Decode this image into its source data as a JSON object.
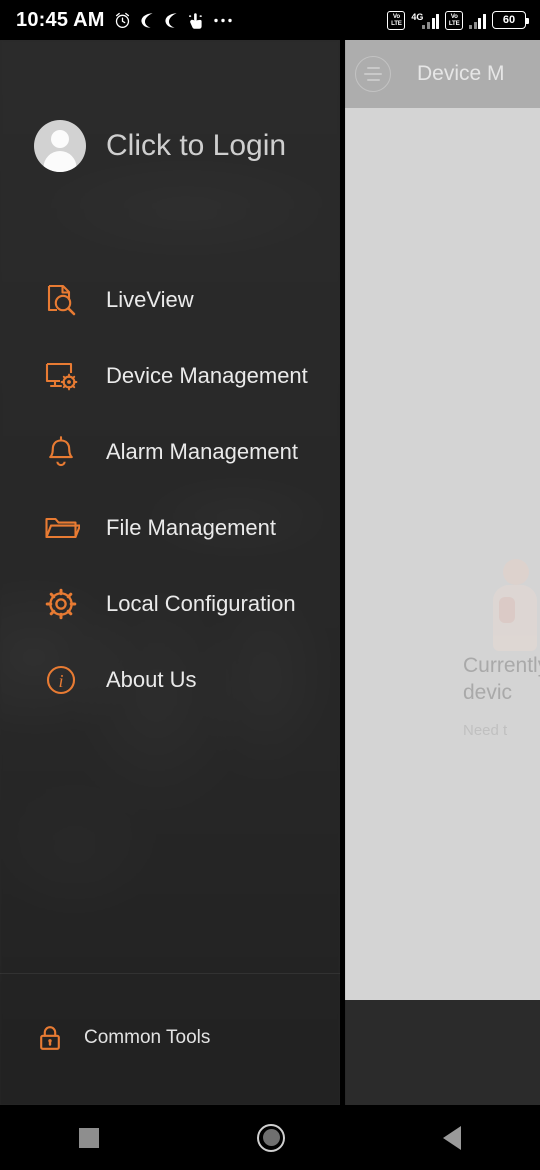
{
  "status_bar": {
    "time": "10:45 AM",
    "left_icons": [
      "alarm-clock-icon",
      "crescent-moon-icon",
      "crescent-moon-icon",
      "touch-assist-icon",
      "more-icon"
    ],
    "network_label_1": "Vo\nLTE",
    "network_top": "Vo",
    "network_bottom": "LTE",
    "data_type": "4G",
    "battery_percent": "60"
  },
  "drawer": {
    "login": {
      "label": "Click to Login",
      "avatar_icon": "person-avatar-icon"
    },
    "menu_items": [
      {
        "label": "LiveView",
        "icon": "liveview-document-search-icon"
      },
      {
        "label": "Device Management",
        "icon": "monitor-gear-icon"
      },
      {
        "label": "Alarm Management",
        "icon": "bell-icon"
      },
      {
        "label": "File Management",
        "icon": "folder-icon"
      },
      {
        "label": "Local Configuration",
        "icon": "gear-icon"
      },
      {
        "label": "About Us",
        "icon": "info-circle-icon"
      }
    ],
    "footer": {
      "label": "Common Tools",
      "icon": "lock-icon"
    }
  },
  "content": {
    "app_bar_title": "Device M",
    "menu_icon": "hamburger-menu-icon",
    "empty_state": {
      "line1": "Currently",
      "line2": "devic",
      "sub": "Need t",
      "illustration": "no-device-illustration"
    }
  },
  "nav_bar": {
    "recents": "recents-square-icon",
    "home": "home-circle-icon",
    "back": "back-triangle-icon"
  },
  "colors": {
    "accent_orange": "#e87b33",
    "drawer_bg": "#2e2e2e",
    "content_panel": "#d4d4d4",
    "app_bar": "#adadad"
  }
}
